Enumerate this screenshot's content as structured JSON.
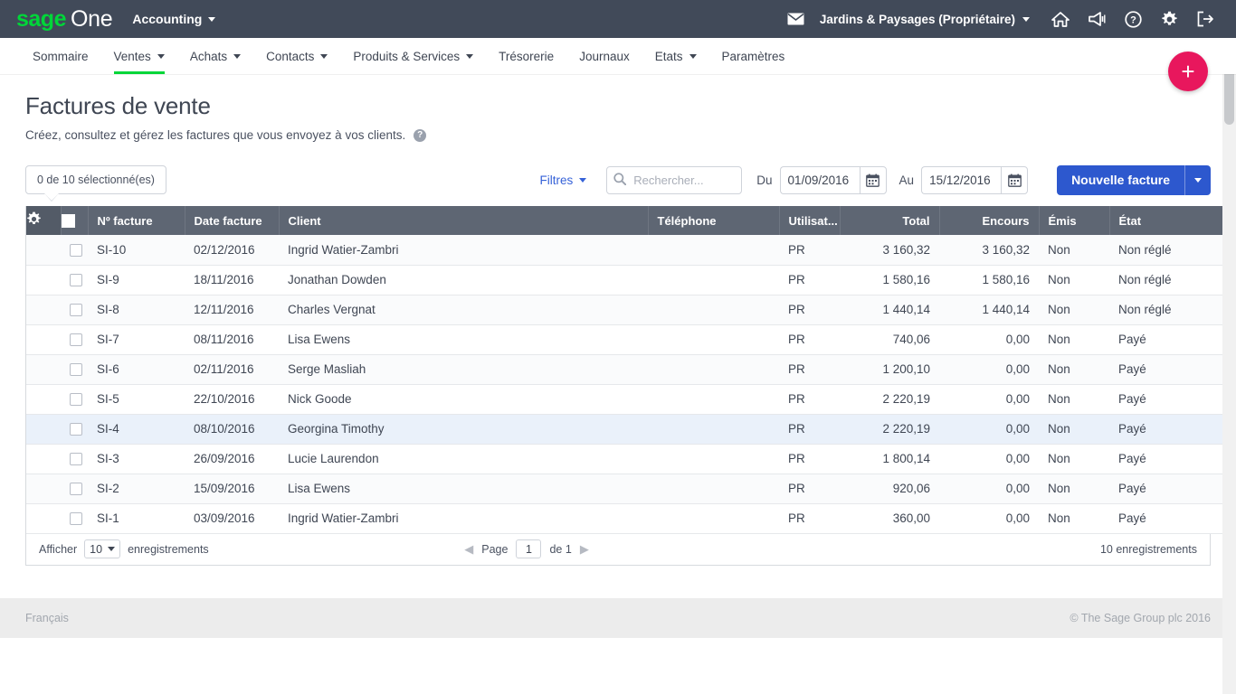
{
  "topbar": {
    "logo_sage": "sage",
    "logo_one": "One",
    "module": "Accounting",
    "company": "Jardins & Paysages (Propriétaire)",
    "icons": [
      "mail-icon",
      "home-icon",
      "megaphone-icon",
      "help-icon",
      "gear-icon",
      "logout-icon"
    ]
  },
  "nav": {
    "items": [
      {
        "label": "Sommaire",
        "caret": false,
        "active": false
      },
      {
        "label": "Ventes",
        "caret": true,
        "active": true
      },
      {
        "label": "Achats",
        "caret": true,
        "active": false
      },
      {
        "label": "Contacts",
        "caret": true,
        "active": false
      },
      {
        "label": "Produits & Services",
        "caret": true,
        "active": false
      },
      {
        "label": "Trésorerie",
        "caret": false,
        "active": false
      },
      {
        "label": "Journaux",
        "caret": false,
        "active": false
      },
      {
        "label": "Etats",
        "caret": true,
        "active": false
      },
      {
        "label": "Paramètres",
        "caret": false,
        "active": false
      }
    ]
  },
  "fab": {
    "label": "+"
  },
  "page": {
    "title": "Factures de vente",
    "subtitle": "Créez, consultez et gérez les factures que vous envoyez à vos clients.",
    "help_glyph": "?"
  },
  "toolbar": {
    "selection": "0 de 10 sélectionné(es)",
    "filters_label": "Filtres",
    "search_placeholder": "Rechercher...",
    "search_value": "",
    "date_from_label": "Du",
    "date_from_value": "01/09/2016",
    "date_to_label": "Au",
    "date_to_value": "15/12/2016",
    "new_button": "Nouvelle facture"
  },
  "table": {
    "columns": [
      "Nº facture",
      "Date facture",
      "Client",
      "Téléphone",
      "Utilisat...",
      "Total",
      "Encours",
      "Émis",
      "État"
    ],
    "rows": [
      {
        "num": "SI-10",
        "date": "02/12/2016",
        "client": "Ingrid Watier-Zambri",
        "tel": "",
        "util": "PR",
        "total": "3 160,32",
        "encours": "3 160,32",
        "emis": "Non",
        "etat": "Non réglé",
        "highlight": false
      },
      {
        "num": "SI-9",
        "date": "18/11/2016",
        "client": "Jonathan Dowden",
        "tel": "",
        "util": "PR",
        "total": "1 580,16",
        "encours": "1 580,16",
        "emis": "Non",
        "etat": "Non réglé",
        "highlight": false
      },
      {
        "num": "SI-8",
        "date": "12/11/2016",
        "client": "Charles Vergnat",
        "tel": "",
        "util": "PR",
        "total": "1 440,14",
        "encours": "1 440,14",
        "emis": "Non",
        "etat": "Non réglé",
        "highlight": false
      },
      {
        "num": "SI-7",
        "date": "08/11/2016",
        "client": "Lisa Ewens",
        "tel": "",
        "util": "PR",
        "total": "740,06",
        "encours": "0,00",
        "emis": "Non",
        "etat": "Payé",
        "highlight": false
      },
      {
        "num": "SI-6",
        "date": "02/11/2016",
        "client": "Serge Masliah",
        "tel": "",
        "util": "PR",
        "total": "1 200,10",
        "encours": "0,00",
        "emis": "Non",
        "etat": "Payé",
        "highlight": false
      },
      {
        "num": "SI-5",
        "date": "22/10/2016",
        "client": "Nick Goode",
        "tel": "",
        "util": "PR",
        "total": "2 220,19",
        "encours": "0,00",
        "emis": "Non",
        "etat": "Payé",
        "highlight": false
      },
      {
        "num": "SI-4",
        "date": "08/10/2016",
        "client": "Georgina Timothy",
        "tel": "",
        "util": "PR",
        "total": "2 220,19",
        "encours": "0,00",
        "emis": "Non",
        "etat": "Payé",
        "highlight": true
      },
      {
        "num": "SI-3",
        "date": "26/09/2016",
        "client": "Lucie Laurendon",
        "tel": "",
        "util": "PR",
        "total": "1 800,14",
        "encours": "0,00",
        "emis": "Non",
        "etat": "Payé",
        "highlight": false
      },
      {
        "num": "SI-2",
        "date": "15/09/2016",
        "client": "Lisa Ewens",
        "tel": "",
        "util": "PR",
        "total": "920,06",
        "encours": "0,00",
        "emis": "Non",
        "etat": "Payé",
        "highlight": false
      },
      {
        "num": "SI-1",
        "date": "03/09/2016",
        "client": "Ingrid Watier-Zambri",
        "tel": "",
        "util": "PR",
        "total": "360,00",
        "encours": "0,00",
        "emis": "Non",
        "etat": "Payé",
        "highlight": false
      }
    ]
  },
  "table_footer": {
    "show_label": "Afficher",
    "page_size": "10",
    "records_label": "enregistrements",
    "page_label": "Page",
    "page_value": "1",
    "of_label": "de 1",
    "total_records": "10 enregistrements"
  },
  "footer": {
    "language": "Français",
    "copyright": "© The Sage Group plc 2016"
  },
  "colors": {
    "topbar_bg": "#414a59",
    "logo_green": "#00d639",
    "accent_green": "#00d639",
    "primary_blue": "#2d58ce",
    "link_blue": "#3662d8",
    "fab_pink": "#e8175d",
    "table_header_bg": "#5e6673",
    "row_highlight": "#eaf1fa",
    "footer_bg": "#ececec"
  }
}
